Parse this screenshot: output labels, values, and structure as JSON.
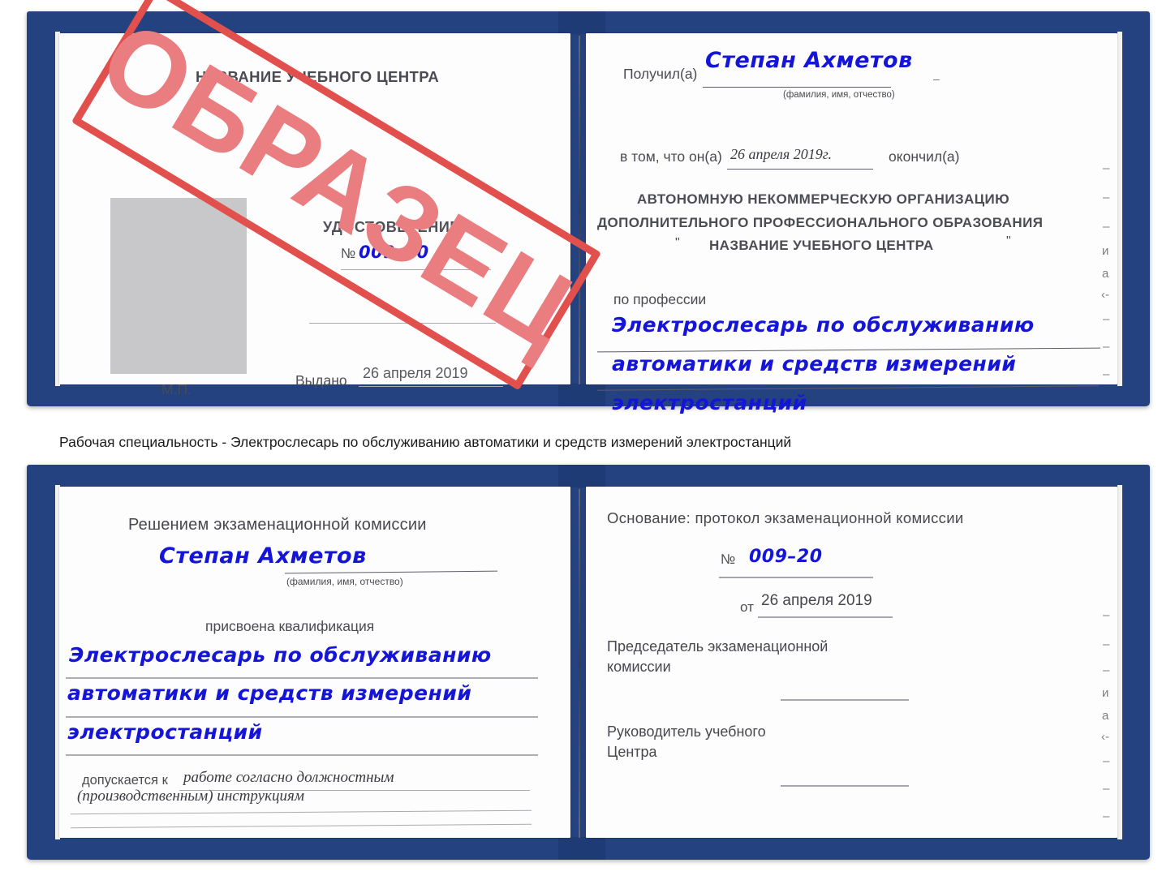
{
  "caption": "Рабочая специальность - Электрослесарь по обслуживанию автоматики и средств измерений электростанций",
  "colors": {
    "cover_blue": "#24427f",
    "stamp_border_red": "#e2504e",
    "stamp_text_red": "#ea7d7f",
    "handwriting_blue": "#1515d8",
    "print_grey": "#4c4c54",
    "photo_placeholder_grey": "#c8c8ca"
  },
  "certificate_top": {
    "left_page": {
      "center_name": "НАЗВАНИЕ УЧЕБНОГО ЦЕНТРА",
      "doc_title": "УДОСТОВЕРЕНИЕ",
      "number_symbol": "№",
      "number_value": "009–20",
      "issued_label": "Выдано",
      "issued_date": "26 апреля 2019",
      "stamp_place_label": "М.П.",
      "photo_placeholder": "photo-placeholder"
    },
    "right_page": {
      "received_label": "Получил(а)",
      "received_name": "Степан Ахметов",
      "fio_hint": "(фамилия, имя, отчество)",
      "that_he_label": "в том, что он(а)",
      "finish_date": "26 апреля 2019г.",
      "graduated_label": "окончил(а)",
      "org_line1": "АВТОНОМНУЮ НЕКОММЕРЧЕСКУЮ ОРГАНИЗАЦИЮ",
      "org_line2": "ДОПОЛНИТЕЛЬНОГО ПРОФЕССИОНАЛЬНОГО ОБРАЗОВАНИЯ",
      "org_quote_open": "\"",
      "org_line3": "НАЗВАНИЕ УЧЕБНОГО ЦЕНТРА",
      "org_quote_close": "\"",
      "profession_label": "по профессии",
      "profession_line1": "Электрослесарь по обслуживанию",
      "profession_line2": "автоматики и средств измерений",
      "profession_line3": "электростанций",
      "edge_fragments": [
        "–",
        "–",
        "–",
        "и",
        "а",
        "‹-",
        "–",
        "–",
        "–"
      ]
    }
  },
  "certificate_bottom": {
    "left_page": {
      "decision_title": "Решением экзаменационной комиссии",
      "name": "Степан Ахметов",
      "fio_hint": "(фамилия, имя, отчество)",
      "qualification_label": "присвоена квалификация",
      "qualification_line1": "Электрослесарь по обслуживанию",
      "qualification_line2": "автоматики и средств измерений",
      "qualification_line3": "электростанций",
      "admitted_label": "допускается к",
      "admitted_line1": "работе согласно должностным",
      "admitted_line2": "(производственным) инструкциям"
    },
    "right_page": {
      "basis_label": "Основание: протокол экзаменационной комиссии",
      "number_symbol": "№",
      "number_value": "009–20",
      "date_label": "от",
      "date_value": "26 апреля 2019",
      "chairman_line1": "Председатель экзаменационной",
      "chairman_line2": "комиссии",
      "head_line1": "Руководитель учебного",
      "head_line2": "Центра",
      "edge_fragments": [
        "–",
        "–",
        "–",
        "и",
        "а",
        "‹-",
        "–",
        "–",
        "–"
      ]
    }
  },
  "stamp": {
    "text": "ОБРАЗЕЦ"
  }
}
